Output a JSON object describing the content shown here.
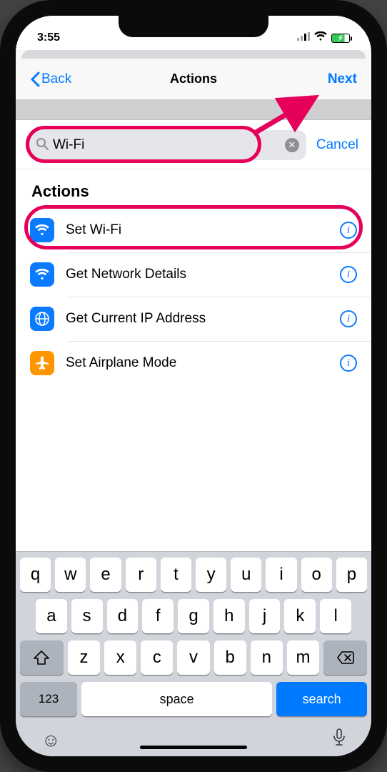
{
  "status": {
    "time": "3:55"
  },
  "nav": {
    "back": "Back",
    "title": "Actions",
    "next": "Next"
  },
  "search": {
    "value": "Wi-Fi",
    "cancel": "Cancel"
  },
  "section_title": "Actions",
  "actions": [
    {
      "label": "Set Wi-Fi",
      "icon": "wifi",
      "bg": "ic-blue"
    },
    {
      "label": "Get Network Details",
      "icon": "wifi",
      "bg": "ic-blue"
    },
    {
      "label": "Get Current IP Address",
      "icon": "globe",
      "bg": "ic-globe"
    },
    {
      "label": "Set Airplane Mode",
      "icon": "airplane",
      "bg": "ic-orange"
    }
  ],
  "keyboard": {
    "row1": [
      "q",
      "w",
      "e",
      "r",
      "t",
      "y",
      "u",
      "i",
      "o",
      "p"
    ],
    "row2": [
      "a",
      "s",
      "d",
      "f",
      "g",
      "h",
      "j",
      "k",
      "l"
    ],
    "row3": [
      "z",
      "x",
      "c",
      "v",
      "b",
      "n",
      "m"
    ],
    "num": "123",
    "space": "space",
    "search": "search"
  }
}
